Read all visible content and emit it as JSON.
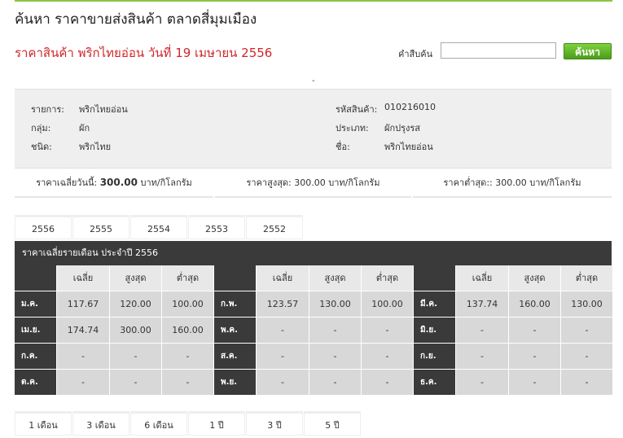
{
  "header": {
    "title": "ค้นหา ราคาขายส่งสินค้า ตลาดสี่มุมเมือง",
    "subtitle": "ราคาสินค้า พริกไทยอ่อน วันที่ 19 เมษายน 2556"
  },
  "search": {
    "label": "คำสืบค้น",
    "value": "",
    "button": "ค้นหา"
  },
  "divider_text": "-",
  "info": {
    "item_label": "รายการ:",
    "item_value": "พริกไทยอ่อน",
    "group_label": "กลุ่ม:",
    "group_value": "ผัก",
    "kind_label": "ชนิด:",
    "kind_value": "พริกไทย",
    "code_label": "รหัสสินค้า:",
    "code_value": "010216010",
    "type_label": "ประเภท:",
    "type_value": "ผักปรุงรส",
    "name_label": "ชื่อ:",
    "name_value": "พริกไทยอ่อน"
  },
  "stats": {
    "avg_label": "ราคาเฉลี่ยวันนี้:",
    "avg_value": "300.00",
    "avg_unit": "บาท/กิโลกรัม",
    "max_label": "ราคาสูงสุด:",
    "max_value": "300.00",
    "max_unit": "บาท/กิโลกรัม",
    "min_label": "ราคาต่ำสุด::",
    "min_value": "300.00",
    "min_unit": "บาท/กิโลกรัม"
  },
  "year_tabs": [
    "2556",
    "2555",
    "2554",
    "2553",
    "2552"
  ],
  "monthly": {
    "heading": "ราคาเฉลี่ยรายเดือน ประจำปี 2556",
    "col_avg": "เฉลี่ย",
    "col_max": "สูงสุด",
    "col_min": "ต่ำสุด",
    "rows": [
      [
        [
          "ม.ค.",
          "117.67",
          "120.00",
          "100.00"
        ],
        [
          "ก.พ.",
          "123.57",
          "130.00",
          "100.00"
        ],
        [
          "มี.ค.",
          "137.74",
          "160.00",
          "130.00"
        ]
      ],
      [
        [
          "เม.ย.",
          "174.74",
          "300.00",
          "160.00"
        ],
        [
          "พ.ค.",
          "-",
          "-",
          "-"
        ],
        [
          "มิ.ย.",
          "-",
          "-",
          "-"
        ]
      ],
      [
        [
          "ก.ค.",
          "-",
          "-",
          "-"
        ],
        [
          "ส.ค.",
          "-",
          "-",
          "-"
        ],
        [
          "ก.ย.",
          "-",
          "-",
          "-"
        ]
      ],
      [
        [
          "ต.ค.",
          "-",
          "-",
          "-"
        ],
        [
          "พ.ย.",
          "-",
          "-",
          "-"
        ],
        [
          "ธ.ค.",
          "-",
          "-",
          "-"
        ]
      ]
    ]
  },
  "range_tabs": [
    "1 เดือน",
    "3 เดือน",
    "6 เดือน",
    "1 ปี",
    "3 ปี",
    "5 ปี"
  ],
  "colors": {
    "accent_green": "#8cc63f",
    "title_red": "#d0262a",
    "dark_header": "#3a3a3a"
  }
}
